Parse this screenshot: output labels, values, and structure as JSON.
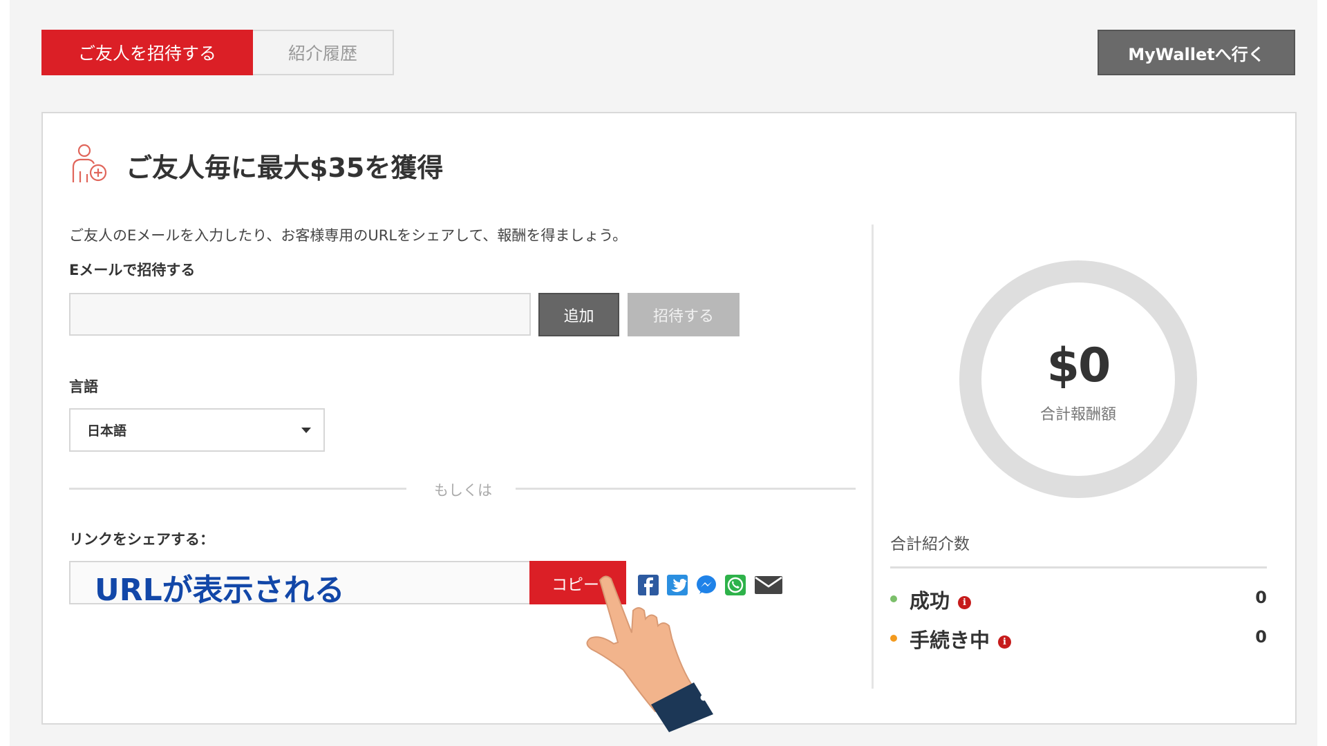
{
  "tabs": {
    "invite_label": "ご友人を招待する",
    "history_label": "紹介履歴"
  },
  "wallet_button_label": "MyWalletへ行く",
  "heading": {
    "icon": "user-add-icon",
    "title": "ご友人毎に最大$35を獲得"
  },
  "invite_form": {
    "description": "ご友人のEメールを入力したり、お客様専用のURLをシェアして、報酬を得ましょう。",
    "email_label": "Eメールで招待する",
    "email_value": "",
    "add_button": "追加",
    "send_button": "招待する",
    "language_label": "言語",
    "language_selected": "日本語",
    "or_divider": "もしくは",
    "share_link_label": "リンクをシェアする：",
    "url_annotation": "URLが表示される",
    "copy_button": "コピー",
    "share_icons": [
      "facebook-icon",
      "twitter-icon",
      "messenger-icon",
      "whatsapp-icon",
      "email-icon"
    ]
  },
  "rewards": {
    "total_amount": "$0",
    "total_label": "合計報酬額",
    "referrals_title": "合計紹介数",
    "stats": [
      {
        "label": "成功",
        "value": "0",
        "color": "#7bbf6a"
      },
      {
        "label": "手続き中",
        "value": "0",
        "color": "#f39a1e"
      }
    ]
  },
  "colors": {
    "brand_red": "#db1f26",
    "dark_button": "#666666",
    "disabled_button": "#b8b8b8",
    "annotation_blue": "#1247a8"
  }
}
